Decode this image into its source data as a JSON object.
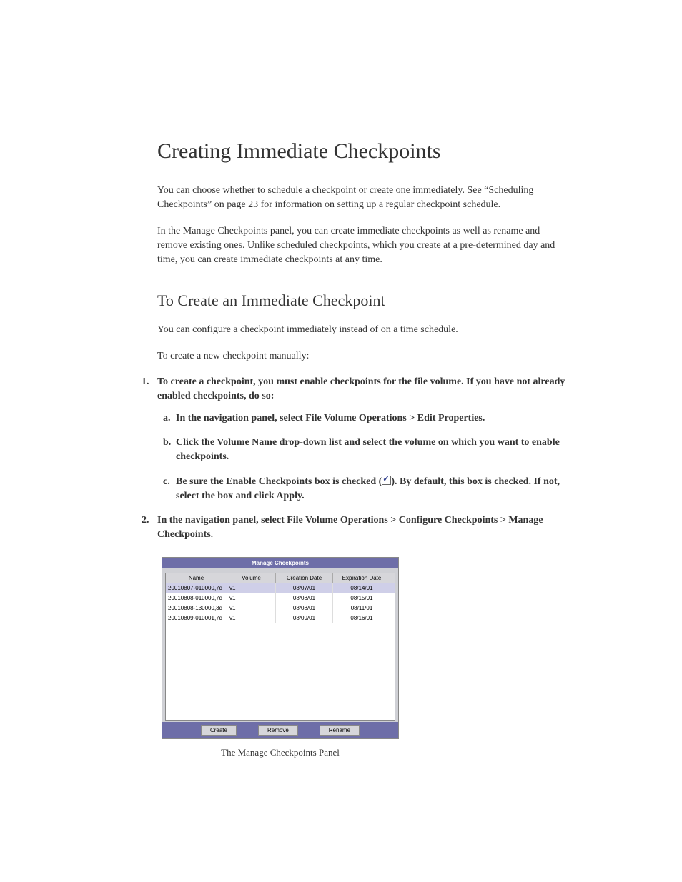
{
  "heading": "Creating Immediate Checkpoints",
  "para1": "You can choose whether to schedule a checkpoint or create one immediately. See “Scheduling Checkpoints” on page 23 for information on setting up a regular checkpoint schedule.",
  "para2": "In the Manage Checkpoints panel, you can create immediate checkpoints as well as rename and remove existing ones. Unlike scheduled checkpoints, which you create at a pre-determined day and time, you can create immediate checkpoints at any time.",
  "subheading": "To Create an Immediate Checkpoint",
  "para3": "You can configure a checkpoint immediately instead of on a time schedule.",
  "para4": "To create a new checkpoint manually:",
  "step1": "To create a checkpoint, you must enable checkpoints for the file volume. If you have not already enabled checkpoints, do so:",
  "step1a": "In the navigation panel, select File Volume Operations > Edit Properties.",
  "step1b": "Click the Volume Name drop-down list and select the volume on which you want to enable checkpoints.",
  "step1c_before": "Be sure the Enable Checkpoints box is checked (",
  "step1c_after": "). By default, this box is checked. If not, select the box and click Apply.",
  "step2": "In the navigation panel, select File Volume Operations > Configure Checkpoints > Manage Checkpoints.",
  "panel": {
    "title": "Manage Checkpoints",
    "headers": {
      "name": "Name",
      "volume": "Volume",
      "creation": "Creation Date",
      "expiration": "Expiration Date"
    },
    "rows": [
      {
        "name": "20010807-010000,7d",
        "vol": "v1",
        "cd": "08/07/01",
        "ed": "08/14/01",
        "selected": true
      },
      {
        "name": "20010808-010000,7d",
        "vol": "v1",
        "cd": "08/08/01",
        "ed": "08/15/01",
        "selected": false
      },
      {
        "name": "20010808-130000,3d",
        "vol": "v1",
        "cd": "08/08/01",
        "ed": "08/11/01",
        "selected": false
      },
      {
        "name": "20010809-010001,7d",
        "vol": "v1",
        "cd": "08/09/01",
        "ed": "08/16/01",
        "selected": false
      }
    ],
    "buttons": {
      "create": "Create",
      "remove": "Remove",
      "rename": "Rename"
    }
  },
  "panel_caption": "The Manage Checkpoints Panel"
}
